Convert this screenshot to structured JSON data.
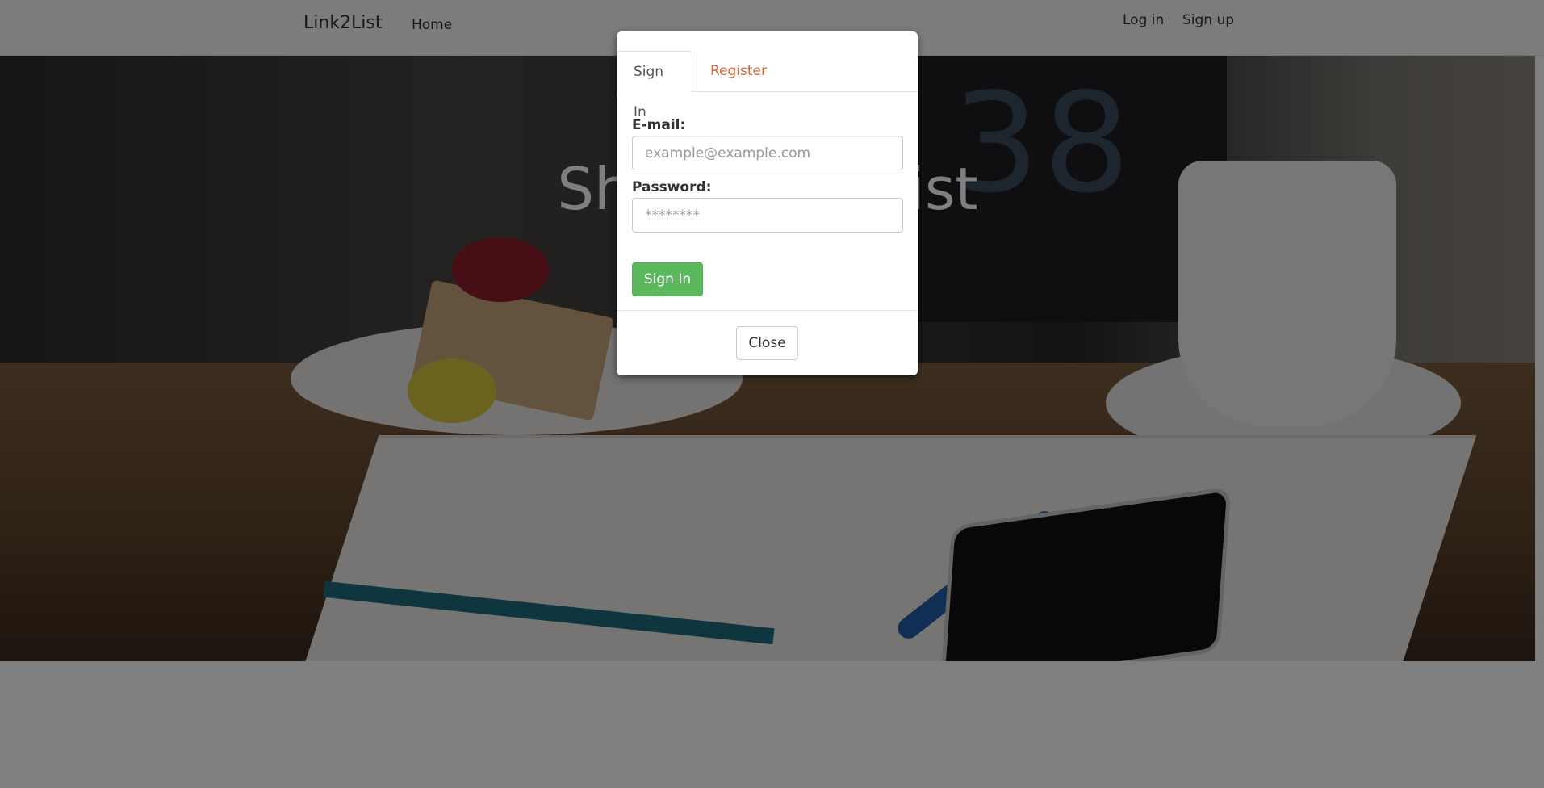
{
  "navbar": {
    "brand": "Link2List",
    "home": "Home",
    "login": "Log in",
    "signup": "Sign up"
  },
  "hero": {
    "title": "Share your list"
  },
  "modal": {
    "tabs": [
      {
        "label": "Sign In",
        "active": true
      },
      {
        "label": "Register",
        "active": false
      }
    ],
    "email_label": "E-mail:",
    "email_placeholder": "example@example.com",
    "password_label": "Password:",
    "password_placeholder": "********",
    "submit_label": "Sign In",
    "close_label": "Close"
  },
  "colors": {
    "success": "#5cb85c",
    "link_accent": "#d9683a",
    "backdrop": "rgba(0,0,0,0.5)"
  }
}
